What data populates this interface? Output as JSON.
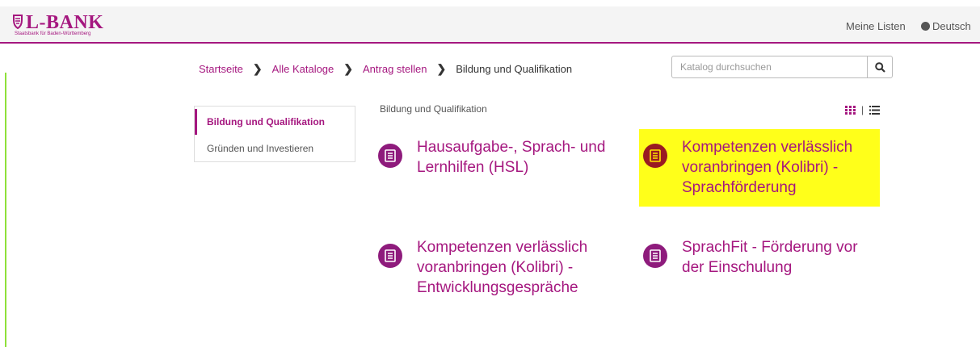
{
  "header": {
    "logo_text": "L-BANK",
    "logo_subtitle": "Staatsbank für Baden-Württemberg",
    "my_lists": "Meine Listen",
    "language": "Deutsch"
  },
  "breadcrumb": [
    {
      "label": "Startseite"
    },
    {
      "label": "Alle Kataloge"
    },
    {
      "label": "Antrag stellen"
    },
    {
      "label": "Bildung und Qualifikation"
    }
  ],
  "search": {
    "placeholder": "Katalog durchsuchen",
    "value": ""
  },
  "sidebar": {
    "items": [
      {
        "label": "Bildung und Qualifikation",
        "active": true
      },
      {
        "label": "Gründen und Investieren",
        "active": false
      }
    ]
  },
  "main": {
    "section_title": "Bildung und Qualifikation",
    "tiles": [
      {
        "title": "Hausaufgabe-, Sprach- und Lernhilfen (HSL)"
      },
      {
        "title": "Kompetenzen verlässlich voranbringen (Kolibri) - Sprachförderung",
        "highlighted": true
      },
      {
        "title": "Kompetenzen verlässlich voranbringen (Kolibri) - Entwicklungsgespräche"
      },
      {
        "title": "SprachFit - Förderung vor der Einschulung"
      }
    ]
  },
  "colors": {
    "brand": "#a5177f",
    "icon_bg": "#8e1b7c",
    "highlight": "#ffff1a"
  }
}
